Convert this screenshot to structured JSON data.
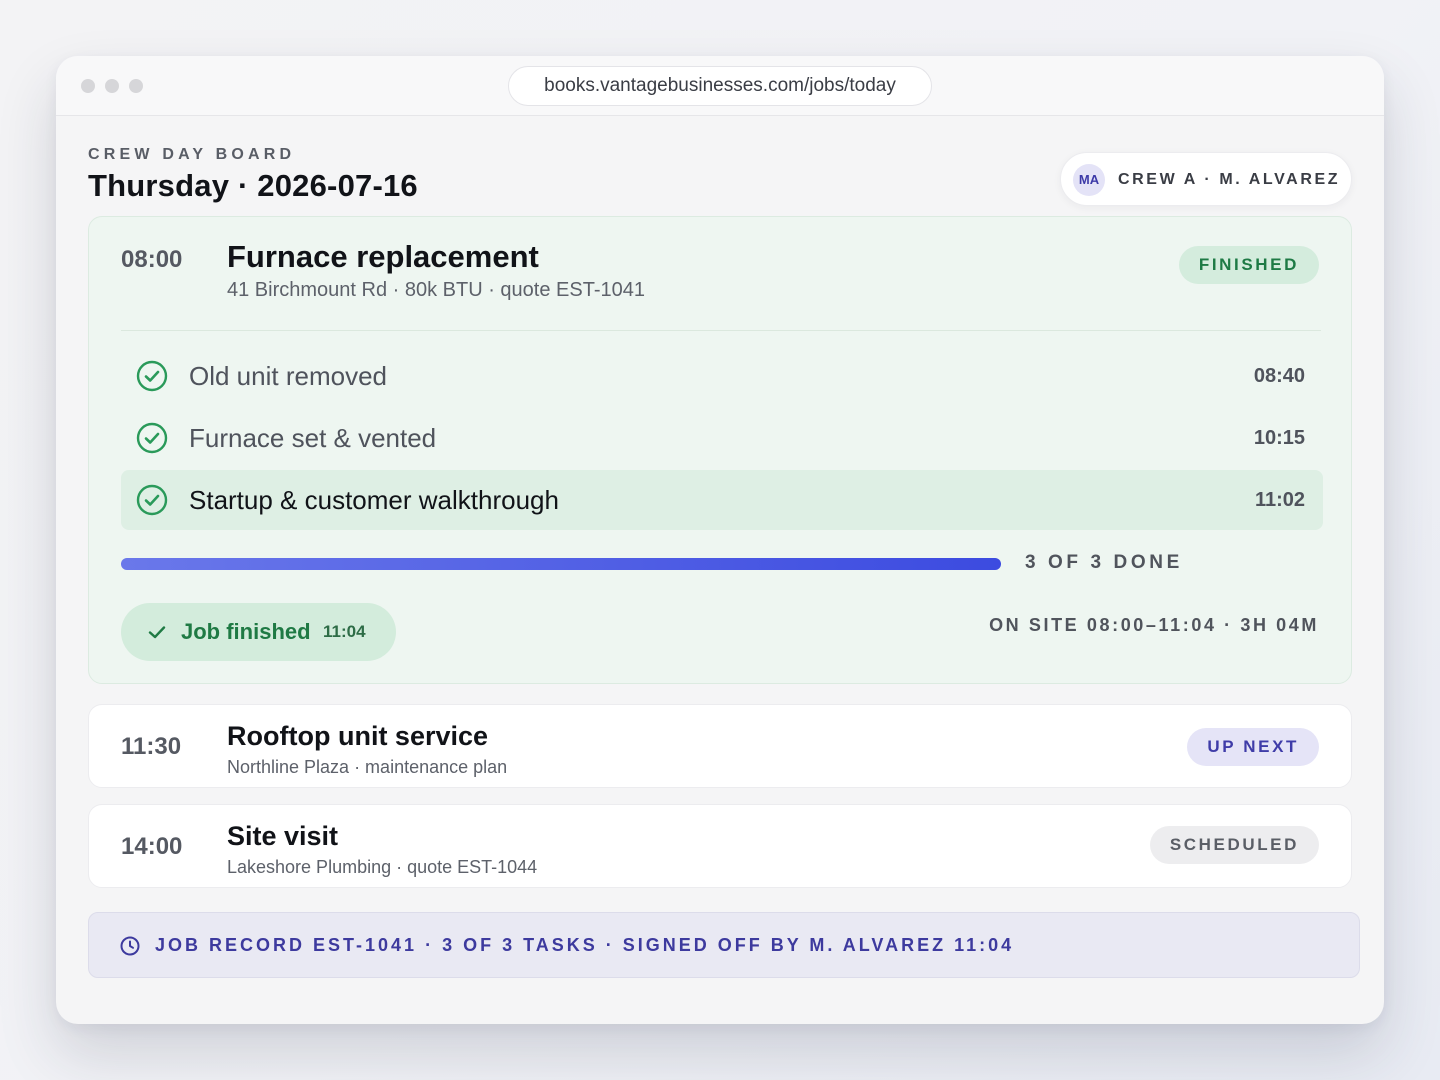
{
  "browser": {
    "url": "books.vantagebusinesses.com/jobs/today"
  },
  "header": {
    "eyebrow": "CREW DAY BOARD",
    "title": "Thursday · 2026-07-16",
    "crew_initials": "MA",
    "crew_label": "CREW A · M. ALVAREZ"
  },
  "jobs": [
    {
      "time": "08:00",
      "title": "Furnace replacement",
      "subtitle": "41 Birchmount Rd · 80k BTU · quote EST-1041",
      "status": "FINISHED",
      "tasks": [
        {
          "label": "Old unit removed",
          "time": "08:40",
          "done": true
        },
        {
          "label": "Furnace set & vented",
          "time": "10:15",
          "done": true
        },
        {
          "label": "Startup & customer walkthrough",
          "time": "11:02",
          "done": true
        }
      ],
      "progress_fraction": 1.0,
      "progress_label": "3 OF 3 DONE",
      "finished_label": "Job finished",
      "finished_time": "11:04",
      "onsite_label": "ON SITE 08:00–11:04 · 3H 04M"
    },
    {
      "time": "11:30",
      "title": "Rooftop unit service",
      "subtitle": "Northline Plaza · maintenance plan",
      "status": "UP NEXT"
    },
    {
      "time": "14:00",
      "title": "Site visit",
      "subtitle": "Lakeshore Plumbing · quote EST-1044",
      "status": "SCHEDULED"
    }
  ],
  "footer": {
    "text": "JOB RECORD EST-1041 · 3 OF 3 TASKS · SIGNED OFF BY M. ALVAREZ 11:04",
    "icon": "clock-icon"
  },
  "colors": {
    "accent": "#3c4be0",
    "success": "#1e7a45",
    "indigo": "#3d3a9e"
  }
}
